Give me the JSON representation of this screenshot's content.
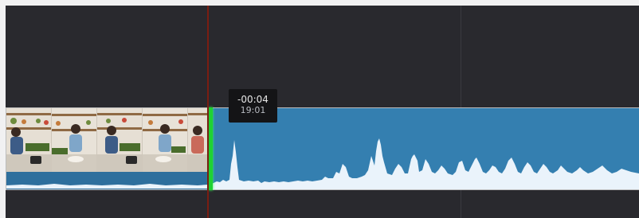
{
  "tooltip": {
    "offset": "-00:04",
    "duration": "19:01"
  },
  "clips": {
    "video_clip": {
      "thumbnail_count": 4
    },
    "audio_clip": {
      "color": "#347fb0"
    }
  },
  "colors": {
    "timeline_bg": "#29292e",
    "trim_edge": "#1fd232",
    "playhead": "#7a1d12",
    "waveform": "#eaf3fb"
  }
}
